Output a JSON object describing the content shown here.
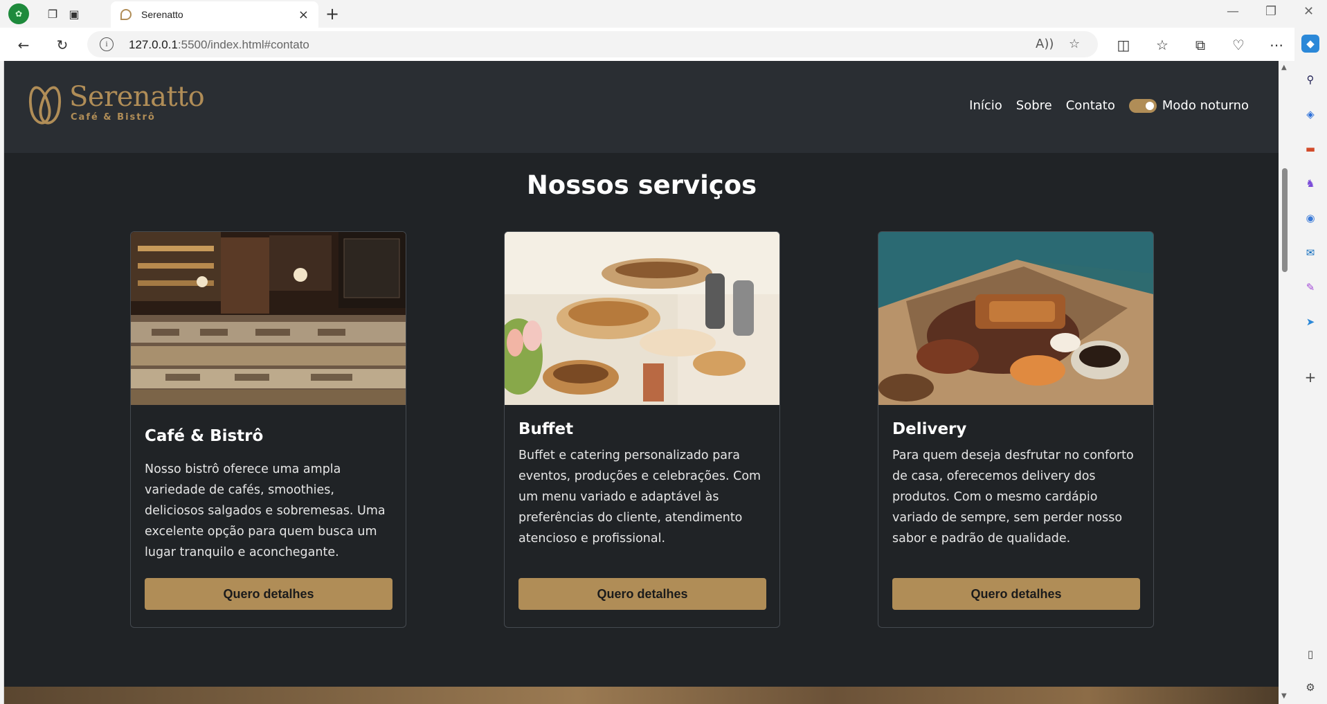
{
  "browser": {
    "tab_title": "Serenatto",
    "url_host": "127.0.0.1",
    "url_rest": ":5500/index.html#contato"
  },
  "header": {
    "brand": "Serenatto",
    "brand_sub": "Café & Bistrô",
    "nav": [
      "Início",
      "Sobre",
      "Contato"
    ],
    "mode_label": "Modo noturno",
    "mode_on": true
  },
  "services": {
    "title": "Nossos serviços",
    "cards": [
      {
        "title": "Café & Bistrô",
        "description": "Nosso bistrô oferece uma ampla variedade de cafés, smoothies, deliciosos salgados e sobremesas. Uma excelente opção para quem busca um lugar tranquilo e aconchegante.",
        "button": "Quero detalhes",
        "image": "cafe-counter-photo"
      },
      {
        "title": "Buffet",
        "description": "Buffet e catering personalizado para eventos, produções e celebrações. Com um menu variado e adaptável às preferências do cliente, atendimento atencioso e profissional.",
        "button": "Quero detalhes",
        "image": "buffet-table-photo"
      },
      {
        "title": "Delivery",
        "description": "Para quem deseja desfrutar no conforto de casa, oferecemos delivery dos produtos. Com o mesmo cardápio variado de sempre, sem perder nosso sabor e padrão de qualidade.",
        "button": "Quero detalhes",
        "image": "delivery-box-photo"
      }
    ]
  },
  "colors": {
    "accent": "#b08d57",
    "background": "#202326",
    "header_bg": "#2a2e33"
  }
}
